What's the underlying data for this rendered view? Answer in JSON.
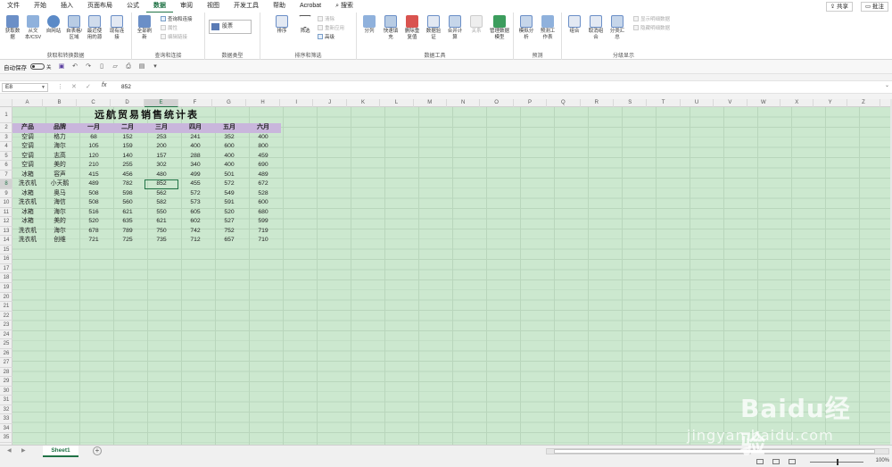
{
  "menu": {
    "tabs": [
      "文件",
      "开始",
      "插入",
      "页面布局",
      "公式",
      "数据",
      "审阅",
      "视图",
      "开发工具",
      "帮助",
      "Acrobat"
    ],
    "active_tab": "数据",
    "search": "搜索",
    "share": "共享",
    "comment": "批注"
  },
  "ribbon": {
    "get_data": {
      "label": "获取和转换数据",
      "buttons": [
        "获取数据",
        "从文本/CSV",
        "自网站",
        "自表格/区域",
        "最近使用的源",
        "现有连接"
      ]
    },
    "queries": {
      "label": "查询和连接",
      "refresh_all": "全部刷新",
      "queries_connections": "查询和连接",
      "properties": "属性",
      "edit_links": "编辑链接"
    },
    "data_types": {
      "label": "数据类型",
      "stocks": "股票"
    },
    "sort_filter": {
      "label": "排序和筛选",
      "sort": "排序",
      "filter": "筛选",
      "clear": "清除",
      "reapply": "重新应用",
      "advanced": "高级"
    },
    "data_tools": {
      "label": "数据工具",
      "buttons": [
        "分列",
        "快速填充",
        "删除重复值",
        "数据验证",
        "合并计算",
        "关系",
        "管理数据模型"
      ]
    },
    "forecast": {
      "label": "预测",
      "buttons": [
        "模拟分析",
        "预测工作表"
      ]
    },
    "outline": {
      "label": "分级显示",
      "group": "组合",
      "ungroup": "取消组合",
      "subtotal": "分类汇总",
      "show_detail": "显示明细数据",
      "hide_detail": "隐藏明细数据"
    }
  },
  "qat": {
    "autosave": "自动保存",
    "toggle": "关"
  },
  "formula_bar": {
    "name_box": "E8",
    "fx": "fx",
    "value": "852"
  },
  "grid": {
    "columns": [
      "A",
      "B",
      "C",
      "D",
      "E",
      "F",
      "G",
      "H",
      "I",
      "J",
      "K",
      "L",
      "M",
      "N",
      "O",
      "P",
      "Q",
      "R",
      "S",
      "T",
      "U",
      "V",
      "W",
      "X",
      "Y",
      "Z"
    ],
    "selected_column": "E",
    "selected_row": "8",
    "row_numbers": [
      "1",
      "2",
      "3",
      "4",
      "5",
      "6",
      "7",
      "8",
      "9",
      "10",
      "11",
      "12",
      "13",
      "14",
      "15",
      "16",
      "17",
      "18",
      "19",
      "20",
      "21",
      "22",
      "23",
      "24",
      "25",
      "26",
      "27",
      "28",
      "29",
      "30",
      "31",
      "32",
      "33",
      "34",
      "35",
      "36"
    ],
    "title": "远航贸易销售统计表",
    "headers": [
      "产品",
      "品牌",
      "一月",
      "二月",
      "三月",
      "四月",
      "五月",
      "六月"
    ],
    "rows": [
      [
        "空调",
        "格力",
        "68",
        "152",
        "253",
        "241",
        "352",
        "400"
      ],
      [
        "空调",
        "海尔",
        "105",
        "159",
        "200",
        "400",
        "600",
        "800"
      ],
      [
        "空调",
        "志高",
        "120",
        "140",
        "157",
        "288",
        "400",
        "459"
      ],
      [
        "空调",
        "美的",
        "210",
        "255",
        "302",
        "340",
        "400",
        "690"
      ],
      [
        "冰箱",
        "容声",
        "415",
        "456",
        "480",
        "499",
        "501",
        "489"
      ],
      [
        "洗衣机",
        "小天鹅",
        "489",
        "782",
        "852",
        "455",
        "572",
        "672"
      ],
      [
        "冰箱",
        "奥马",
        "508",
        "598",
        "562",
        "572",
        "549",
        "528"
      ],
      [
        "洗衣机",
        "海信",
        "508",
        "560",
        "582",
        "573",
        "591",
        "600"
      ],
      [
        "冰箱",
        "海尔",
        "516",
        "621",
        "550",
        "605",
        "520",
        "680"
      ],
      [
        "冰箱",
        "美的",
        "520",
        "635",
        "621",
        "602",
        "527",
        "599"
      ],
      [
        "洗衣机",
        "海尔",
        "678",
        "789",
        "750",
        "742",
        "752",
        "719"
      ],
      [
        "洗衣机",
        "创维",
        "721",
        "725",
        "735",
        "712",
        "657",
        "710"
      ]
    ]
  },
  "sheets": {
    "active": "Sheet1",
    "add": "+"
  },
  "status": {
    "zoom": "100%"
  },
  "watermark": {
    "main": "Baidu经验",
    "sub": "jingyan.baidu.com"
  },
  "colors": {
    "accent": "#217346",
    "grid_bg": "#cce8cf",
    "header_fill": "#c9b6dc"
  }
}
